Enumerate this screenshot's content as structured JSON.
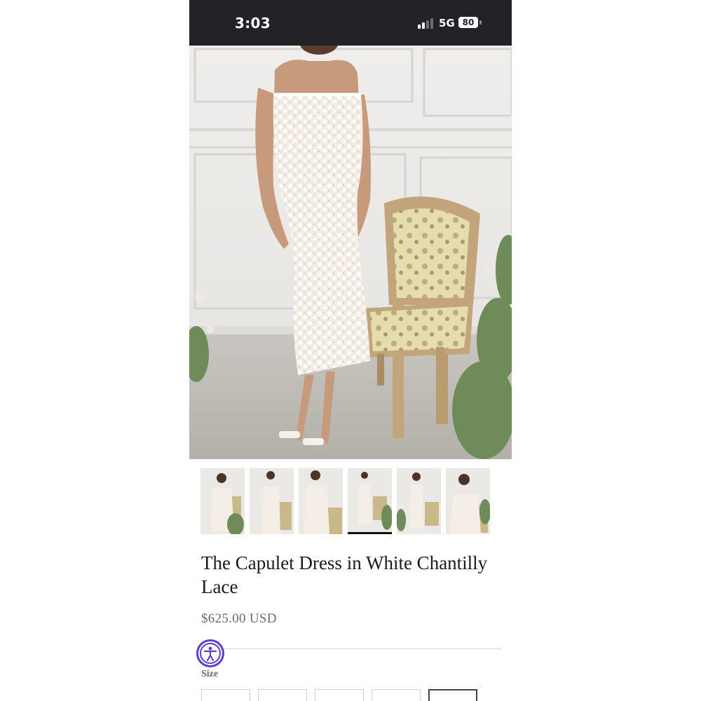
{
  "status_bar": {
    "time": "3:03",
    "network": "5G",
    "battery": "80"
  },
  "product": {
    "title": "The Capulet Dress in White Chantilly Lace",
    "price": "$625.00 USD",
    "gallery_count": 6,
    "active_thumbnail_index": 3
  },
  "options": {
    "size_label": "Size",
    "size_button_count": 5
  },
  "icons": {
    "accessibility": "accessibility-icon"
  },
  "colors": {
    "status_bar_bg": "#222326",
    "accessibility_accent": "#5b3fc4",
    "price_text": "#6b6b6b"
  }
}
